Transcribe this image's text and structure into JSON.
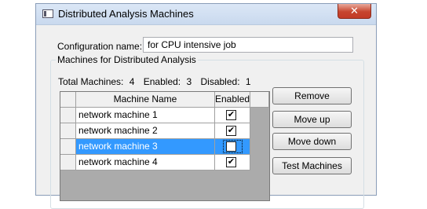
{
  "window": {
    "title": "Distributed Analysis Machines",
    "close_label": "✕"
  },
  "config": {
    "label": "Configuration name:",
    "value": "for CPU intensive job"
  },
  "machines_group": {
    "label": "Machines for Distributed Analysis",
    "total_label": "Total Machines:",
    "total": "4",
    "enabled_label": "Enabled:",
    "enabled": "3",
    "disabled_label": "Disabled:",
    "disabled": "1"
  },
  "grid": {
    "columns": [
      "Machine Name",
      "Enabled"
    ],
    "rows": [
      {
        "name": "network machine 1",
        "enabled": true,
        "selected": false
      },
      {
        "name": "network machine 2",
        "enabled": true,
        "selected": false
      },
      {
        "name": "network machine 3",
        "enabled": false,
        "selected": true
      },
      {
        "name": "network machine 4",
        "enabled": true,
        "selected": false
      }
    ]
  },
  "buttons": {
    "remove": "Remove",
    "move_up": "Move up",
    "move_down": "Move down",
    "test": "Test Machines"
  },
  "colors": {
    "selection": "#3399ff",
    "close": "#c7452f"
  },
  "icons": {
    "app": "window-app-icon",
    "check": "✔"
  }
}
